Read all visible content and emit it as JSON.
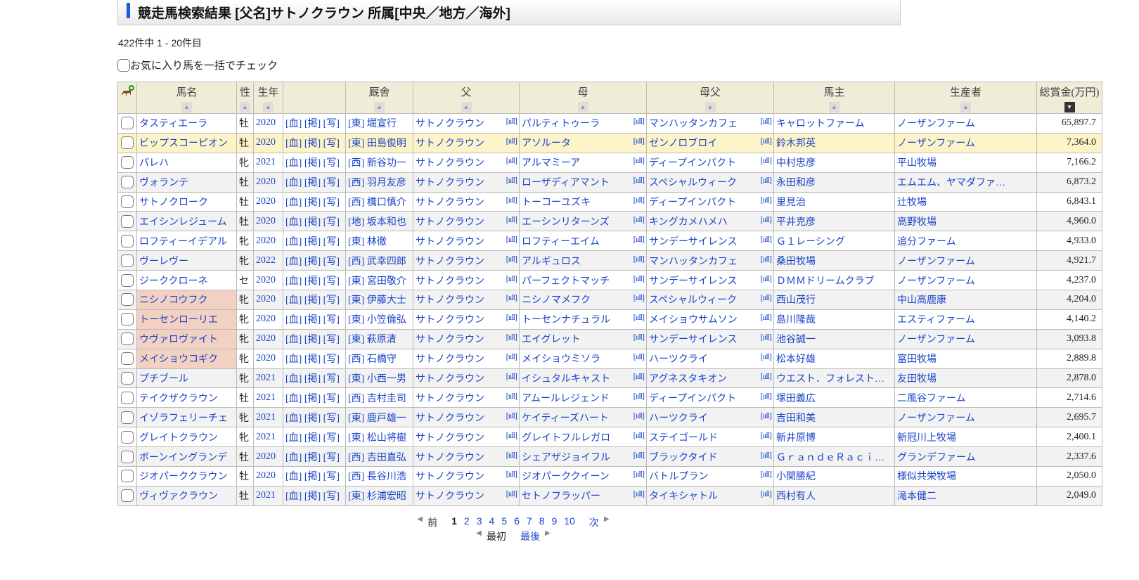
{
  "title": "競走馬検索結果 [父名]サトノクラウン 所属[中央／地方／海外]",
  "count": "422件中  1 - 20件目",
  "bulk_check": "お気に入り馬を一括でチェック",
  "headers": [
    "馬名",
    "性",
    "生年",
    "",
    "厩舎",
    "父",
    "母",
    "母父",
    "馬主",
    "生産者",
    "総賞金(万円)"
  ],
  "link_labels": [
    "[血]",
    "[掲]",
    "[写]"
  ],
  "chart_icon": "[ııll]",
  "rows": [
    [
      "タスティエーラ",
      "牡",
      "2020",
      "[東]",
      "堀宣行",
      "サトノクラウン",
      "パルティトゥーラ",
      "マンハッタンカフェ",
      "キャロットファーム",
      "ノーザンファーム",
      "65,897.7"
    ],
    [
      "ビップスコーピオン",
      "牡",
      "2020",
      "[東]",
      "田島俊明",
      "サトノクラウン",
      "アソルータ",
      "ゼンノロブロイ",
      "鈴木邦英",
      "ノーザンファーム",
      "7,364.0"
    ],
    [
      "パレハ",
      "牝",
      "2021",
      "[西]",
      "新谷功一",
      "サトノクラウン",
      "アルマミーア",
      "ディープインパクト",
      "中村忠彦",
      "平山牧場",
      "7,166.2"
    ],
    [
      "ヴォランテ",
      "牡",
      "2020",
      "[西]",
      "羽月友彦",
      "サトノクラウン",
      "ローザディアマント",
      "スペシャルウィーク",
      "永田和彦",
      "エムエム、ヤマダファ…",
      "6,873.2"
    ],
    [
      "サトノクローク",
      "牡",
      "2020",
      "[西]",
      "橋口慎介",
      "サトノクラウン",
      "トーコーユズキ",
      "ディープインパクト",
      "里見治",
      "辻牧場",
      "6,843.1"
    ],
    [
      "エイシンレジューム",
      "牡",
      "2020",
      "[地]",
      "坂本和也",
      "サトノクラウン",
      "エーシンリターンズ",
      "キングカメハメハ",
      "平井克彦",
      "高野牧場",
      "4,960.0"
    ],
    [
      "ロフティーイデアル",
      "牝",
      "2020",
      "[東]",
      "林徹",
      "サトノクラウン",
      "ロフティーエイム",
      "サンデーサイレンス",
      "Ｇ１レーシング",
      "追分ファーム",
      "4,933.0"
    ],
    [
      "ヴーレヴー",
      "牝",
      "2022",
      "[西]",
      "武幸四郎",
      "サトノクラウン",
      "アルギュロス",
      "マンハッタンカフェ",
      "桑田牧場",
      "ノーザンファーム",
      "4,921.7"
    ],
    [
      "ジーククローネ",
      "セ",
      "2020",
      "[東]",
      "宮田敬介",
      "サトノクラウン",
      "パーフェクトマッチ",
      "サンデーサイレンス",
      "ＤＭＭドリームクラブ",
      "ノーザンファーム",
      "4,237.0"
    ],
    [
      "ニシノコウフク",
      "牝",
      "2020",
      "[東]",
      "伊藤大士",
      "サトノクラウン",
      "ニシノマメフク",
      "スペシャルウィーク",
      "西山茂行",
      "中山高鹿康",
      "4,204.0"
    ],
    [
      "トーセンローリエ",
      "牝",
      "2020",
      "[東]",
      "小笠倫弘",
      "サトノクラウン",
      "トーセンナチュラル",
      "メイショウサムソン",
      "島川隆哉",
      "エスティファーム",
      "4,140.2"
    ],
    [
      "ウヴァロヴァイト",
      "牝",
      "2020",
      "[東]",
      "萩原清",
      "サトノクラウン",
      "エイグレット",
      "サンデーサイレンス",
      "池谷誠一",
      "ノーザンファーム",
      "3,093.8"
    ],
    [
      "メイショウコギク",
      "牝",
      "2020",
      "[西]",
      "石橋守",
      "サトノクラウン",
      "メイショウミソラ",
      "ハーツクライ",
      "松本好雄",
      "富田牧場",
      "2,889.8"
    ],
    [
      "プチブール",
      "牝",
      "2021",
      "[東]",
      "小西一男",
      "サトノクラウン",
      "イシュタルキャスト",
      "アグネスタキオン",
      "ウエスト．フォレスト…",
      "友田牧場",
      "2,878.0"
    ],
    [
      "テイクザクラウン",
      "牡",
      "2021",
      "[西]",
      "吉村圭司",
      "サトノクラウン",
      "アムールレジェンド",
      "ディープインパクト",
      "塚田義広",
      "二風谷ファーム",
      "2,714.6"
    ],
    [
      "イゾラフェリーチェ",
      "牝",
      "2021",
      "[東]",
      "鹿戸雄一",
      "サトノクラウン",
      "ケイティーズハート",
      "ハーツクライ",
      "吉田和美",
      "ノーザンファーム",
      "2,695.7"
    ],
    [
      "グレイトクラウン",
      "牝",
      "2021",
      "[東]",
      "松山将樹",
      "サトノクラウン",
      "グレイトフルレガロ",
      "ステイゴールド",
      "新井原博",
      "新冠川上牧場",
      "2,400.1"
    ],
    [
      "ボーンイングランデ",
      "牡",
      "2020",
      "[西]",
      "吉田直弘",
      "サトノクラウン",
      "シェアザジョイフル",
      "ブラックタイド",
      "ＧｒａｎｄｅＲａｃｉ…",
      "グランデファーム",
      "2,337.6"
    ],
    [
      "ジオパーククラウン",
      "牡",
      "2020",
      "[西]",
      "長谷川浩",
      "サトノクラウン",
      "ジオパーククイーン",
      "バトルプラン",
      "小関勝紀",
      "様似共栄牧場",
      "2,050.0"
    ],
    [
      "ヴィヴァクラウン",
      "牡",
      "2021",
      "[東]",
      "杉浦宏昭",
      "サトノクラウン",
      "セトノフラッパー",
      "タイキシャトル",
      "西村有人",
      "滝本健二",
      "2,049.0"
    ]
  ],
  "highlight_row": 1,
  "pink_rows": [
    9,
    10,
    11,
    12
  ],
  "pager": {
    "prev": "前",
    "pages": [
      "1",
      "2",
      "3",
      "4",
      "5",
      "6",
      "7",
      "8",
      "9",
      "10"
    ],
    "current": "1",
    "next": "次",
    "first": "最初",
    "last": "最後"
  },
  "colors": {
    "accent": "#1a5fd6",
    "link": "#1a44c8",
    "header_bg": "#efedd8",
    "highlight": "#fdf3c8",
    "pink": "#f3d1c2"
  }
}
